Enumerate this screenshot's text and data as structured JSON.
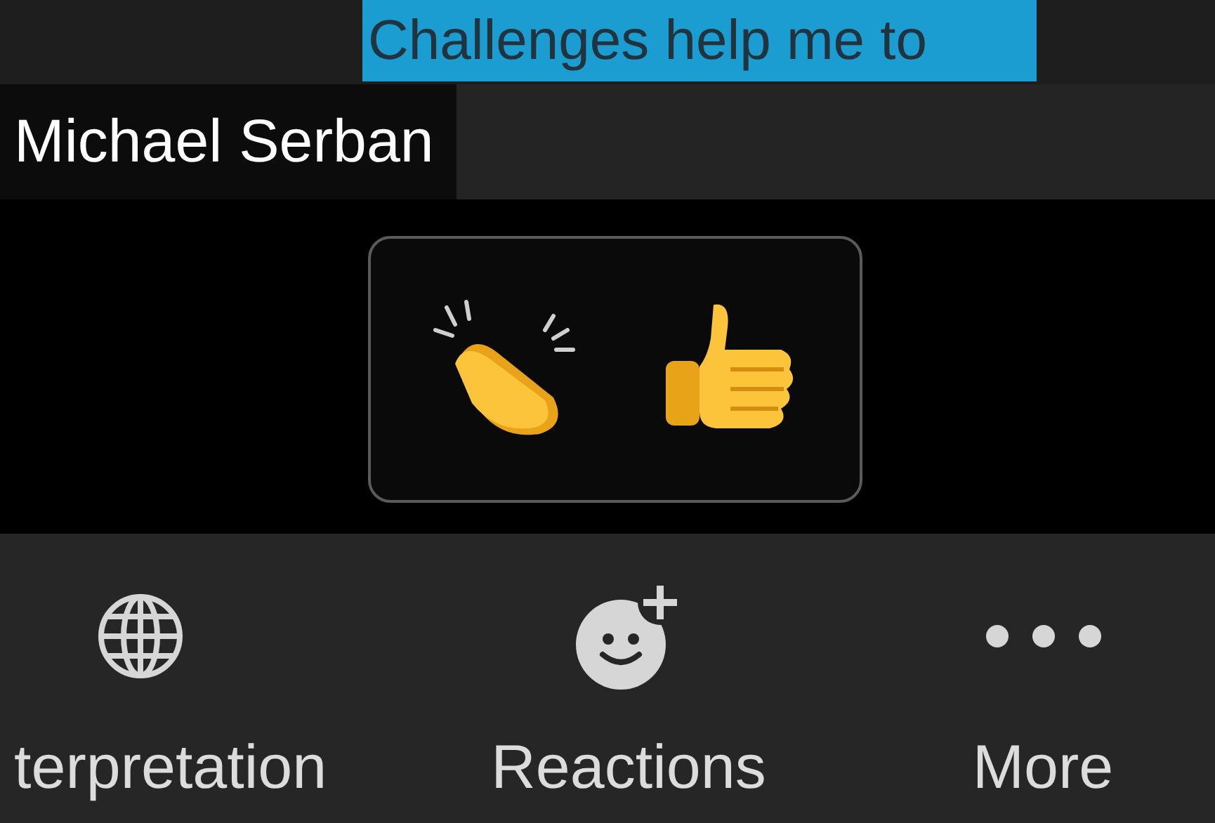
{
  "caption": {
    "text": "Challenges help me to"
  },
  "participant": {
    "name": "Michael Serban"
  },
  "reactions": [
    {
      "kind": "clap"
    },
    {
      "kind": "thumbs_up"
    }
  ],
  "toolbar": [
    {
      "kind": "globe",
      "label": "terpretation"
    },
    {
      "kind": "reaction",
      "label": "Reactions"
    },
    {
      "kind": "more",
      "label": "More"
    }
  ]
}
